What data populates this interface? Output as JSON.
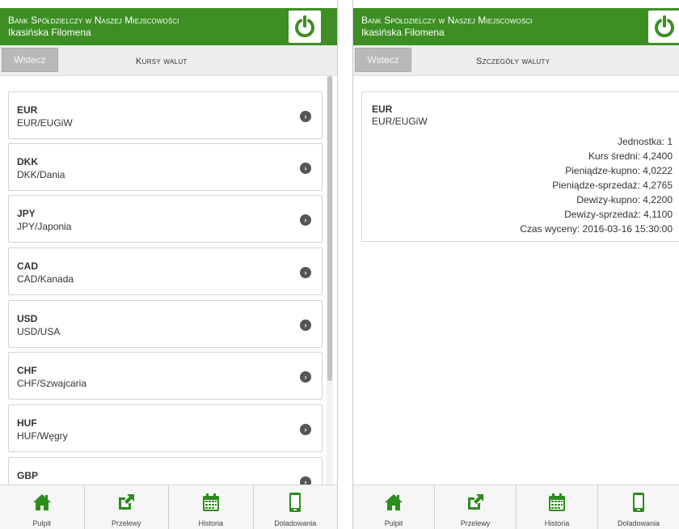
{
  "app": {
    "bank_name": "Bank Spółdzielczy w Naszej Miejscowości",
    "user_name": "Ikasińska Filomena"
  },
  "colors": {
    "header_green": "#3d8f24",
    "icon_green": "#2e8b1e"
  },
  "left_panel": {
    "back_label": "Wstecz",
    "title": "Kursy walut",
    "items": [
      {
        "code": "EUR",
        "desc": "EUR/EUGiW"
      },
      {
        "code": "DKK",
        "desc": "DKK/Dania"
      },
      {
        "code": "JPY",
        "desc": "JPY/Japonia"
      },
      {
        "code": "CAD",
        "desc": "CAD/Kanada"
      },
      {
        "code": "USD",
        "desc": "USD/USA"
      },
      {
        "code": "CHF",
        "desc": "CHF/Szwajcaria"
      },
      {
        "code": "HUF",
        "desc": "HUF/Węgry"
      },
      {
        "code": "GBP",
        "desc": ""
      }
    ]
  },
  "right_panel": {
    "back_label": "Wstecz",
    "title": "Szczegóły waluty",
    "code": "EUR",
    "desc": "EUR/EUGiW",
    "rows": [
      "Jednostka: 1",
      "Kurs średni: 4,2400",
      "Pieniądze-kupno: 4,0222",
      "Pieniądze-sprzedaż: 4,2765",
      "Dewizy-kupno: 4,2200",
      "Dewizy-sprzedaż: 4,1100",
      "Czas wyceny: 2016-03-16 15:30:00"
    ]
  },
  "nav": {
    "items": [
      {
        "label": "Pulpit",
        "icon": "home-icon"
      },
      {
        "label": "Przelewy",
        "icon": "external-link-icon"
      },
      {
        "label": "Historia",
        "icon": "calendar-icon"
      },
      {
        "label": "Doladowania",
        "icon": "mobile-phone-icon"
      }
    ]
  }
}
